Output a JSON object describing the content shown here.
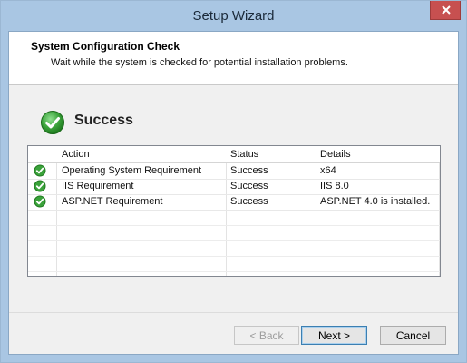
{
  "window": {
    "title": "Setup Wizard"
  },
  "header": {
    "title": "System Configuration Check",
    "subtitle": "Wait while the system is checked for potential installation problems."
  },
  "result": {
    "label": "Success"
  },
  "table": {
    "columns": [
      "Action",
      "Status",
      "Details"
    ],
    "rows": [
      {
        "action": "Operating System Requirement",
        "status": "Success",
        "details": "x64"
      },
      {
        "action": "IIS Requirement",
        "status": "Success",
        "details": "IIS 8.0"
      },
      {
        "action": "ASP.NET Requirement",
        "status": "Success",
        "details": "ASP.NET 4.0 is installed."
      }
    ]
  },
  "buttons": {
    "back": "< Back",
    "next": "Next >",
    "cancel": "Cancel"
  },
  "colors": {
    "titlebar": "#a9c6e3",
    "close": "#c75050",
    "success_green": "#3aa23a"
  }
}
